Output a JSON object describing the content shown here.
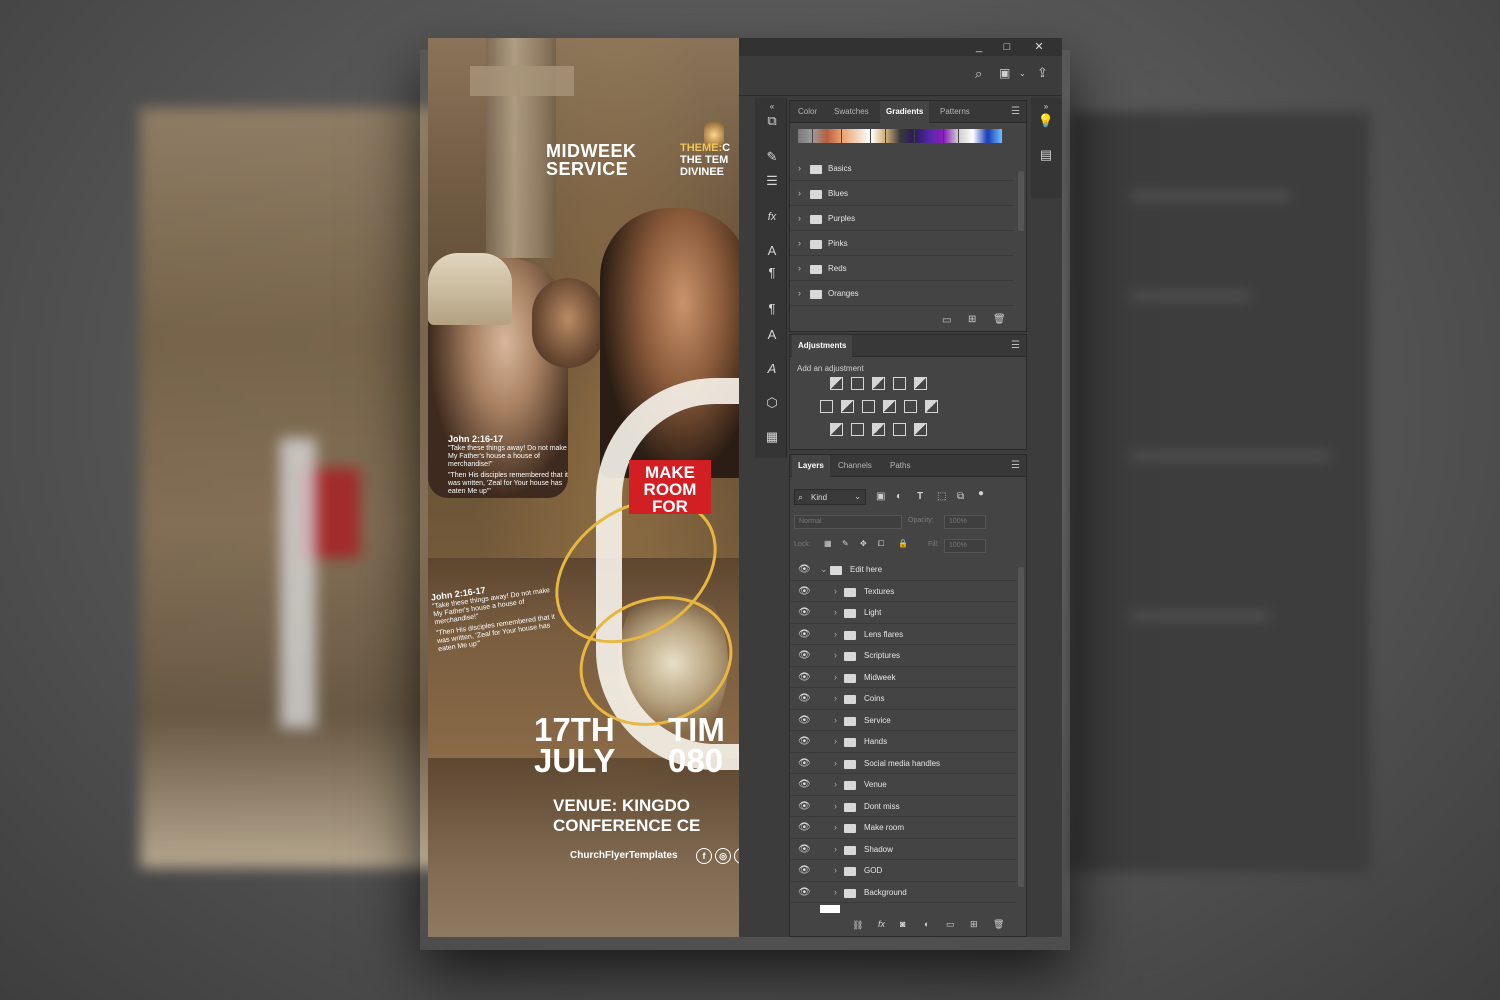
{
  "flyer": {
    "midweek": "MIDWEEK",
    "service": "SERVICE",
    "theme_label": "THEME:",
    "theme_line1": "C",
    "theme_line2": "THE TEM",
    "theme_line3": "DIVINEE",
    "make_room": "MAKE",
    "room": "ROOM",
    "for": "FOR",
    "scripture_ref_1": "John 2:16-17",
    "scripture_text_1a": "\"Take these things away! Do not make My Father's house a house of merchandise!\"",
    "scripture_text_1b": "\"Then His disciples remembered that it was written, 'Zeal for Your house has eaten Me up'\"",
    "scripture_ref_2": "John 2:16-17",
    "date_day": "17TH",
    "date_month": "JULY",
    "time_label": "TIM",
    "time_value": "080",
    "venue_line1": "VENUE: KINGDO",
    "venue_line2": "CONFERENCE CE",
    "handle": "ChurchFlyerTemplates",
    "social_icons": [
      "facebook-icon",
      "instagram-icon"
    ]
  },
  "window_controls": [
    "_",
    "□",
    "✕"
  ],
  "swatches_panel": {
    "tabs": [
      "Color",
      "Swatches",
      "Gradients",
      "Patterns"
    ],
    "active_tab": "Gradients",
    "gradient_colors": [
      "#7a7a7a",
      "#9b9b9b",
      "#b65d3d",
      "#e8a070",
      "#f1d1b4",
      "#ffffff",
      "#d1b07a",
      "#3a3a3a",
      "#2d1a57",
      "#5227a8",
      "#8a1fb8",
      "#cfcfcf",
      "#ffffff",
      "#1d3fb7",
      "#6ec1ff"
    ],
    "folders": [
      "Basics",
      "Blues",
      "Purples",
      "Pinks",
      "Reds",
      "Oranges"
    ]
  },
  "adjustments_panel": {
    "title": "Adjustments",
    "subtitle": "Add an adjustment"
  },
  "layers_panel": {
    "tabs": [
      "Layers",
      "Channels",
      "Paths"
    ],
    "active_tab": "Layers",
    "filter_kind": "Kind",
    "blend_mode": "Normal",
    "opacity_label": "Opacity:",
    "opacity_value": "100%",
    "lock_label": "Lock:",
    "fill_label": "Fill:",
    "fill_value": "100%",
    "group_name": "Edit here",
    "layers": [
      "Textures",
      "Light",
      "Lens flares",
      "Scriptures",
      "Midweek",
      "Coins",
      "Service",
      "Hands",
      "Social media handles",
      "Venue",
      "Dont miss",
      "Make room",
      "Shadow",
      "GOD",
      "Background"
    ]
  }
}
